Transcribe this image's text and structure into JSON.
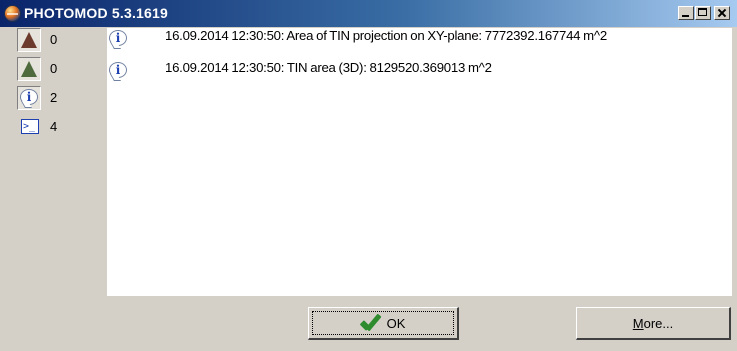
{
  "window": {
    "title": "PHOTOMOD 5.3.1619",
    "icon": "photomod-app-icon"
  },
  "sidebar": {
    "filters": [
      {
        "icon": "error-triangle-icon",
        "count": "0"
      },
      {
        "icon": "warning-triangle-icon",
        "count": "0"
      },
      {
        "icon": "info-icon",
        "count": "2"
      },
      {
        "icon": "console-icon",
        "count": "4"
      }
    ]
  },
  "log": {
    "entries": [
      {
        "icon": "info-icon",
        "text": "16.09.2014 12:30:50: Area of TIN projection on XY-plane: 7772392.167744 m^2"
      },
      {
        "icon": "info-icon",
        "text": "16.09.2014 12:30:50: TIN area (3D): 8129520.369013 m^2"
      }
    ]
  },
  "buttons": {
    "ok_label": "OK",
    "more_first": "M",
    "more_rest": "ore..."
  },
  "colors": {
    "title_start": "#0a246a",
    "title_end": "#a6caf0",
    "face": "#d4d0c8",
    "info_blue": "#1e3fb0",
    "error_brown": "#6b3a2c",
    "warning_green": "#4f6a3c",
    "check_green": "#2e8b2e"
  }
}
